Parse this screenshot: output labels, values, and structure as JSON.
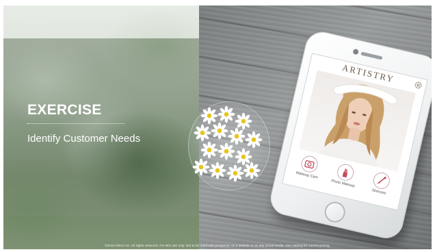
{
  "slide": {
    "title": "EXERCISE",
    "subtitle": "Identify Customer Needs",
    "footer": "©2019 Alticor Inc. All rights reserved. For IBO use only. Not to be used with prospects, on a website or on any social media. See catalog for current pricing."
  },
  "phone": {
    "brand": "ARTISTRY",
    "tools": [
      {
        "label": "Makeup Cam",
        "icon": "camera-icon"
      },
      {
        "label": "Photo Makeup",
        "icon": "lipstick-icon"
      },
      {
        "label": "Skincare",
        "icon": "brush-icon"
      }
    ]
  },
  "colors": {
    "title_text": "#ffffff",
    "brand_text": "#6b5c4b",
    "tool_accent": "#c0485c"
  }
}
